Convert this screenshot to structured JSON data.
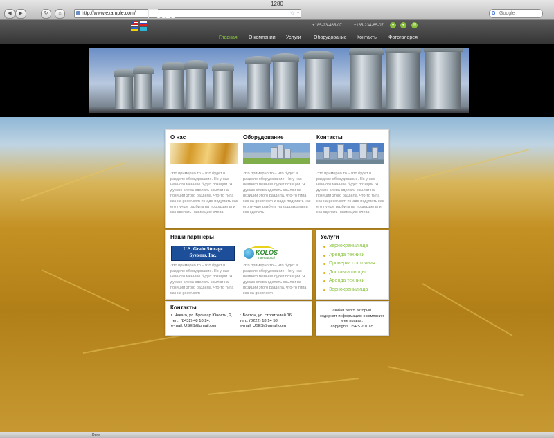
{
  "browser": {
    "window_title": "1280",
    "url": "http://www.example.com/",
    "search_placeholder": "Google",
    "status": "Done",
    "back_icon": "back-arrow-icon",
    "forward_icon": "forward-arrow-icon"
  },
  "header": {
    "logo_text": "USES",
    "phones": [
      "+185-23-465-07",
      "+185-234-65-07"
    ],
    "nav": [
      "Главная",
      "О компании",
      "Услуги",
      "Оборудование",
      "Контакты",
      "Фотогалерея"
    ],
    "active_nav": "Главная",
    "accent_color": "#8ac43f"
  },
  "columns": [
    {
      "title": "О нас",
      "text": "Это примерно то – что будет в разделе оборудование. Но у нас немного меньше будет позиций. Я думаю слева сделать ссылки на позиции этого раздела, что-то типа как на gscor.com и надо подумать как его лучше разбить на подразделы и как сделать навигацию слева."
    },
    {
      "title": "Оборудование",
      "text": "Это примерно то – что будет в разделе оборудование. Но у нас немного меньше будет позиций. Я думаю слева сделать ссылки на позиции этого раздела, что-то типа как на gscor.com и надо подумать как его лучше разбить на подразделы и как сделать"
    },
    {
      "title": "Контакты",
      "text": "Это примерно то – что будет в разделе оборудование. Но у нас немного меньше будет позиций. Я думаю слева сделать ссылки на позиции этого раздела, что-то типа как на gscor.com и надо подумать как его лучше разбить на подразделы и как сделать навигацию слева."
    }
  ],
  "partners": {
    "title": "Наши партнеры",
    "items": [
      {
        "logo_line1": "U.S. Grain Storage",
        "logo_line2": "Systems, Inc.",
        "text": "Это примерно то – что будет в разделе оборудование. Но у нас немного меньше будет позиций. Я думаю слева сделать ссылки на позиции этого раздела, что-то типа как на gscor.com"
      },
      {
        "logo_line1": "KOLOS",
        "logo_line2": "International",
        "text": "Это примерно то – что будет в разделе оборудование. Но у нас немного меньше будет позиций. Я думаю слева сделать ссылки на позиции этого раздела, что-то типа как на gscor.com"
      }
    ]
  },
  "services": {
    "title": "Услуги",
    "items": [
      "Зернохранилища",
      "Аренда техники",
      "Проверка состояния",
      "Доставка пиццы",
      "Аренда техники",
      "Зернохранилища"
    ]
  },
  "contacts": {
    "title": "Контакты",
    "blocks": [
      [
        "г. Чикаго, ул. Бульвар Юности, 2,",
        "тел.: (8432) 48 10 24,",
        "e-mail: USES@gmail.com"
      ],
      [
        "г. Бостон, ул. строителей 16,",
        "тел.: (8222) 18 14 58,",
        "e-mail: USES@gmail.com"
      ]
    ]
  },
  "footnote": [
    "Любая текст, который",
    "содержит информацию о компании",
    "и ее правах.",
    "copyrights USES 2010 c"
  ]
}
